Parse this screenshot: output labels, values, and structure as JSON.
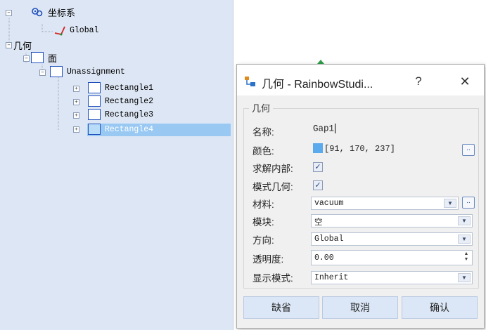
{
  "tree": {
    "coord_system": "坐标系",
    "global": "Global",
    "geometry": "几何",
    "face": "面",
    "unassignment": "Unassignment",
    "rectangles": [
      "Rectangle1",
      "Rectangle2",
      "Rectangle3",
      "Rectangle4"
    ],
    "selected_index": 3,
    "expander_plus": "+",
    "expander_minus": "−"
  },
  "dialog": {
    "title": "几何 - RainbowStudi...",
    "help": "?",
    "close": "✕",
    "group_title": "几何",
    "fields": {
      "name_label": "名称:",
      "name_value": "Gap1",
      "color_label": "颜色:",
      "color_value": "[91, 170, 237]",
      "color_hex": "#5baaed",
      "solve_inside_label": "求解内部:",
      "solve_inside_checked": true,
      "model_geometry_label": "模式几何:",
      "model_geometry_checked": true,
      "material_label": "材料:",
      "material_value": "vacuum",
      "module_label": "模块:",
      "module_value": "空",
      "direction_label": "方向:",
      "direction_value": "Global",
      "transparency_label": "透明度:",
      "transparency_value": "0.00",
      "display_mode_label": "显示模式:",
      "display_mode_value": "Inherit"
    },
    "ellipsis": "..",
    "check_mark": "✓",
    "buttons": {
      "default": "缺省",
      "cancel": "取消",
      "ok": "确认"
    }
  },
  "colors": {
    "tree_bg": "#dde6f4",
    "selected_row": "#99c9f3",
    "button_bg": "#dbe7f6",
    "icon_blue": "#1f4fbd"
  }
}
